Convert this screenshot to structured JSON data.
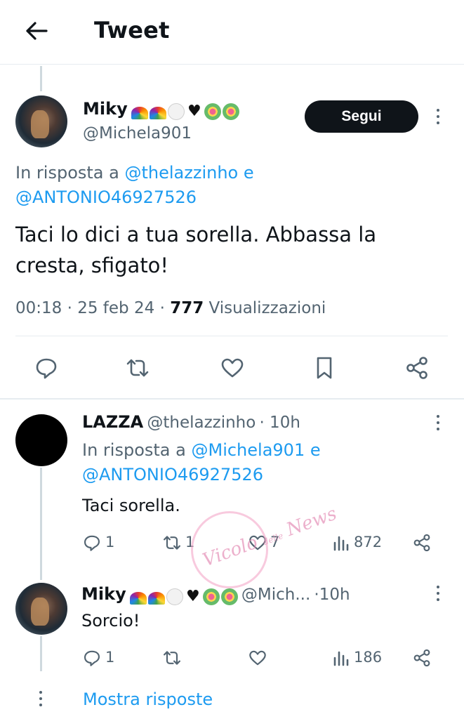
{
  "header": {
    "title": "Tweet"
  },
  "main_tweet": {
    "display_name": "Miky",
    "handle": "@Michela901",
    "follow_label": "Segui",
    "reply_prefix": "In risposta a",
    "reply_user1": "@thelazzinho",
    "reply_and": "e",
    "reply_user2": "@ANTONIO46927526",
    "text_line1": "Taci lo dici a tua sorella. Abbassa la",
    "text_line2": "cresta, sfigato!",
    "time": "00:18",
    "sep": "·",
    "date": "25 feb 24",
    "views_count": "777",
    "views_label": "Visualizzazioni"
  },
  "reply1": {
    "display_name": "LAZZA",
    "handle": "@thelazzinho",
    "age": "· 10h",
    "reply_prefix": "In risposta a",
    "reply_user1": "@Michela901",
    "reply_and": "e",
    "reply_user2": "@ANTONIO46927526",
    "text": "Taci sorella.",
    "replies": "1",
    "retweets": "1",
    "likes": "7",
    "views": "872"
  },
  "reply2": {
    "display_name": "Miky",
    "handle": "@Mich...",
    "age": "·10h",
    "text": "Sorcio!",
    "replies": "1",
    "views": "186"
  },
  "show_replies": "Mostra risposte",
  "watermark": {
    "line1": "Vicolo",
    "line2": "delle",
    "line3": "News"
  },
  "colors": {
    "link": "#1d9bf0",
    "text": "#0f1419",
    "muted": "#536471",
    "border": "#e6ecf0"
  }
}
